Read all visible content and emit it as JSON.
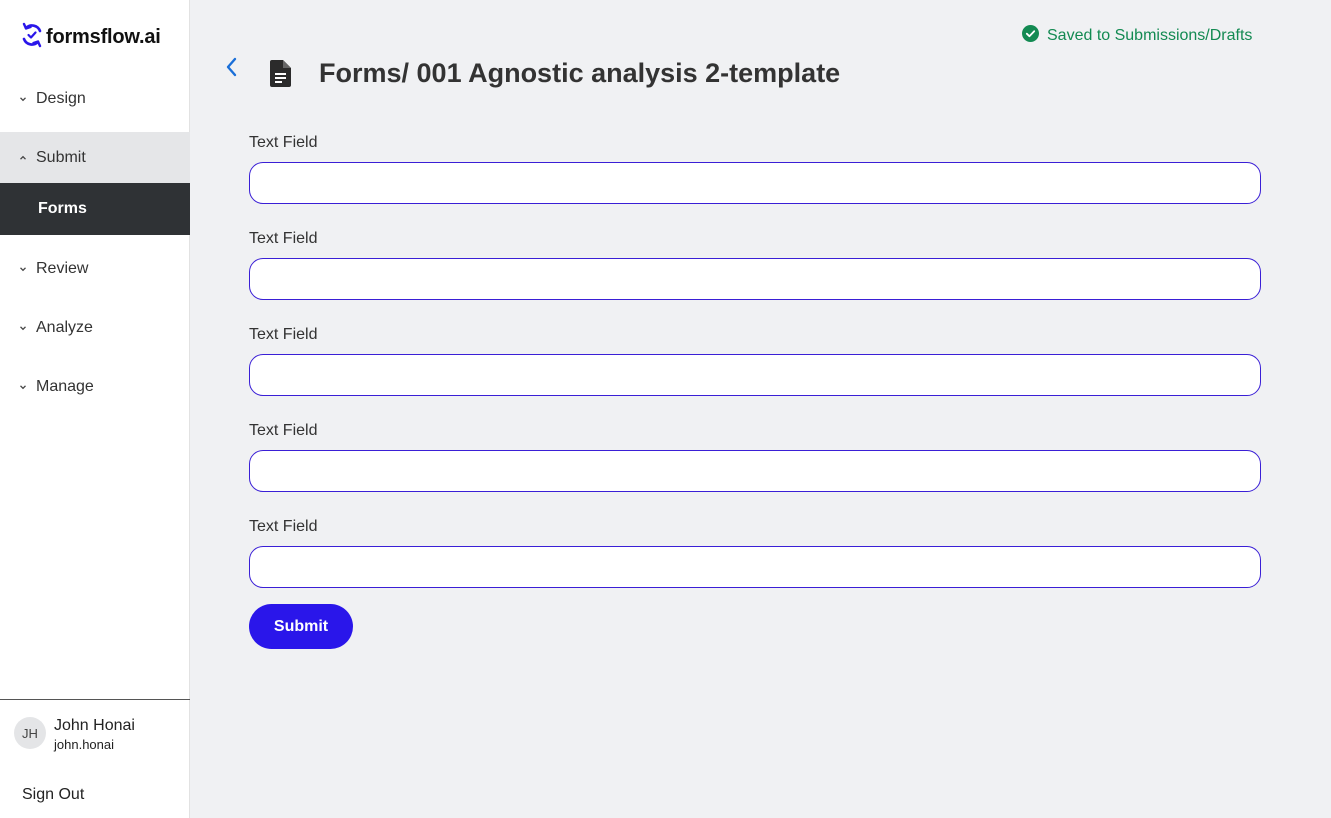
{
  "app": {
    "logo_text": "formsflow.ai"
  },
  "sidebar": {
    "items": [
      {
        "label": "Design",
        "expanded": false
      },
      {
        "label": "Submit",
        "expanded": true
      },
      {
        "label": "Review",
        "expanded": false
      },
      {
        "label": "Analyze",
        "expanded": false
      },
      {
        "label": "Manage",
        "expanded": false
      }
    ],
    "active_subitem": "Forms"
  },
  "user": {
    "initials": "JH",
    "name": "John Honai",
    "username": "john.honai",
    "signout_label": "Sign Out"
  },
  "status": {
    "text": "Saved to Submissions/Drafts",
    "color": "#138a52"
  },
  "header": {
    "breadcrumb_root": "Forms/",
    "form_name": " 001 Agnostic analysis 2-template"
  },
  "form": {
    "fields": [
      {
        "label": "Text Field",
        "value": ""
      },
      {
        "label": "Text Field",
        "value": ""
      },
      {
        "label": "Text Field",
        "value": ""
      },
      {
        "label": "Text Field",
        "value": ""
      },
      {
        "label": "Text Field",
        "value": ""
      }
    ],
    "submit_label": "Submit"
  },
  "colors": {
    "accent": "#2a16ea",
    "input_border": "#3a1fd6",
    "back_arrow": "#1a6fd8",
    "active_nav_bg": "#2f3235"
  },
  "icons": {
    "logo": "formsflow-sync-icon",
    "back": "chevron-left-icon",
    "form": "document-icon",
    "status": "check-circle-icon",
    "nav_collapsed": "chevron-down-icon",
    "nav_expanded": "chevron-up-icon"
  }
}
